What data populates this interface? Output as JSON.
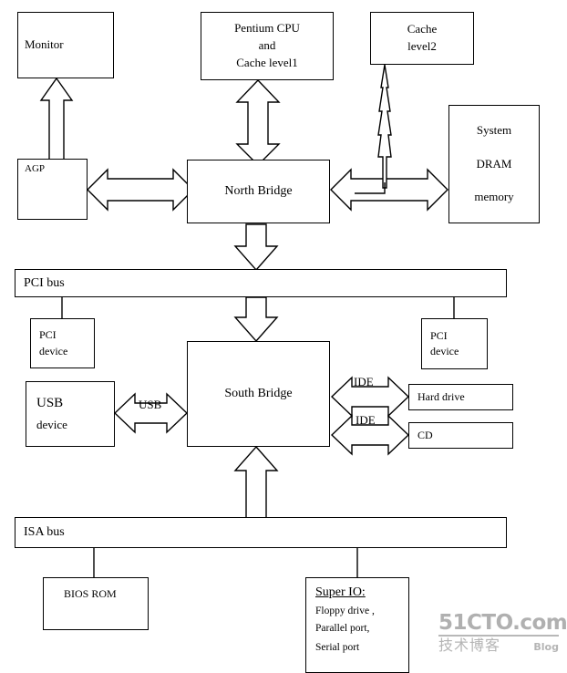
{
  "diagram": {
    "title": "PC Motherboard Chipset Block Diagram",
    "stroke_color": "#000000",
    "background_color": "#ffffff",
    "watermark": {
      "main": "51CTO.com",
      "cn": "技术博客",
      "blog": "Blog"
    },
    "nodes": {
      "monitor": {
        "label": "Monitor"
      },
      "cpu": {
        "line1": "Pentium CPU",
        "line2": "and",
        "line3": "Cache level1"
      },
      "cache_l2": {
        "line1": "Cache",
        "line2": "level2"
      },
      "agp": {
        "label": "AGP"
      },
      "north_bridge": {
        "label": "North Bridge"
      },
      "dram": {
        "line1": "System",
        "line2": "DRAM",
        "line3": "memory"
      },
      "pci_bus": {
        "label": "PCI bus"
      },
      "pci_device_left": {
        "line1": "PCI",
        "line2": "device"
      },
      "pci_device_right": {
        "line1": "PCI",
        "line2": "device"
      },
      "usb_device": {
        "line1": "USB",
        "line2": "device"
      },
      "south_bridge": {
        "label": "South Bridge"
      },
      "hard_drive": {
        "label": "Hard drive"
      },
      "cd": {
        "label": "CD"
      },
      "isa_bus": {
        "label": "ISA bus"
      },
      "bios_rom": {
        "label": "BIOS ROM"
      },
      "super_io": {
        "title": "Super IO:",
        "line1": "Floppy drive ,",
        "line2": "Parallel port,",
        "line3": "Serial port"
      }
    },
    "edge_labels": {
      "usb": "USB",
      "ide_1": "IDE",
      "ide_2": "IDE"
    }
  }
}
